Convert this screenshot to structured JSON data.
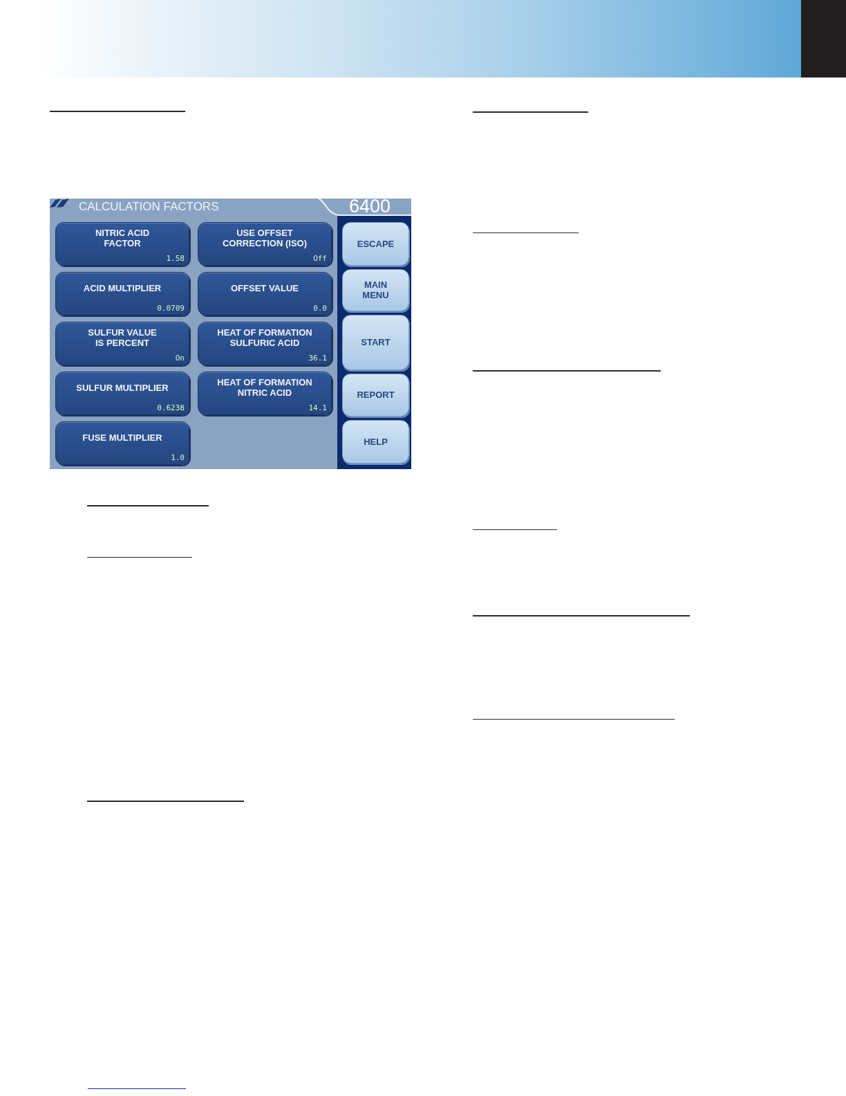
{
  "screen": {
    "title": "CALCULATION FACTORS",
    "model": "6400",
    "setting_rows": [
      [
        {
          "label": "NITRIC ACID\nFACTOR",
          "value": "1.58"
        },
        {
          "label": "USE OFFSET\nCORRECTION (ISO)",
          "value": "Off"
        }
      ],
      [
        {
          "label": "ACID MULTIPLIER",
          "value": "0.0709"
        },
        {
          "label": "OFFSET VALUE",
          "value": "0.0"
        }
      ],
      [
        {
          "label": "SULFUR VALUE\nIS PERCENT",
          "value": "On"
        },
        {
          "label": "HEAT OF FORMATION\nSULFURIC ACID",
          "value": "36.1"
        }
      ],
      [
        {
          "label": "SULFUR MULTIPLIER",
          "value": "0.6238"
        },
        {
          "label": "HEAT OF FORMATION\nNITRIC ACID",
          "value": "14.1"
        }
      ],
      [
        {
          "label": "FUSE MULTIPLIER",
          "value": "1.0"
        }
      ]
    ],
    "side_buttons": [
      "ESCAPE",
      "MAIN\nMENU",
      "START",
      "REPORT",
      "HELP"
    ]
  }
}
